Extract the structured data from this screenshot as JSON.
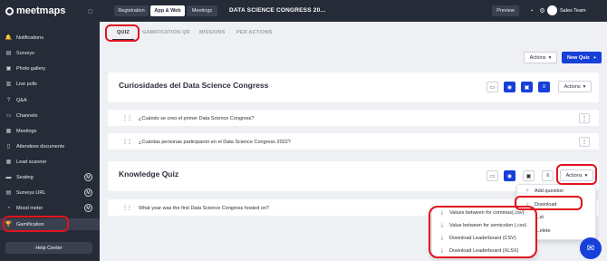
{
  "app": {
    "logo": "meetmaps"
  },
  "sidebar": {
    "items": [
      {
        "label": "Notifications",
        "icon": "bell-icon",
        "glyph": "🔔"
      },
      {
        "label": "Surveys",
        "icon": "clipboard-icon",
        "glyph": "▤"
      },
      {
        "label": "Photo gallery",
        "icon": "image-icon",
        "glyph": "▣"
      },
      {
        "label": "Live polls",
        "icon": "chart-icon",
        "glyph": "▥"
      },
      {
        "label": "Q&A",
        "icon": "qa-icon",
        "glyph": "?"
      },
      {
        "label": "Channels",
        "icon": "chat-icon",
        "glyph": "▭"
      },
      {
        "label": "Meetings",
        "icon": "calendar-icon",
        "glyph": "▦"
      },
      {
        "label": "Attendees documents",
        "icon": "document-icon",
        "glyph": "▯"
      },
      {
        "label": "Lead scanner",
        "icon": "scanner-icon",
        "glyph": "▦"
      },
      {
        "label": "Seating",
        "icon": "seat-icon",
        "glyph": "▬",
        "badge": "M"
      },
      {
        "label": "Surveys URL",
        "icon": "link-icon",
        "glyph": "▤",
        "badge": "M"
      },
      {
        "label": "Mood meter",
        "icon": "mood-icon",
        "glyph": "◔",
        "badge": "M"
      },
      {
        "label": "Gamification",
        "icon": "trophy-icon",
        "glyph": "🏆"
      }
    ],
    "help": "Help Center"
  },
  "topbar": {
    "segments": [
      "Registration",
      "App & Web",
      "Meetings"
    ],
    "event_title": "DATA SCIENCE CONGRESS 20...",
    "preview": "Preview",
    "user": "Sales Team"
  },
  "tabs": [
    "QUIZ",
    "GAMIFICATION QR",
    "MISSIONS",
    "PER ACTIONS"
  ],
  "toolbar": {
    "actions": "Actions",
    "new_quiz": "New Quiz"
  },
  "quiz1": {
    "title": "Curiosidades del Data Science Congress",
    "actions": "Actions",
    "questions": [
      "¿Cuándo se creo el primer Data Science Congress?",
      "¿Cuántas personas participaron en el Data Science Congress 2022?"
    ]
  },
  "quiz2": {
    "title": "Knowledge Quiz",
    "actions": "Actions",
    "questions": [
      "What year was the first Data Science Congress hosted on?"
    ]
  },
  "actions_menu": {
    "add_question": "Add question",
    "download": "Download",
    "partial_1": "...st",
    "partial_2": "...elete"
  },
  "download_menu": [
    "Values between for commas(.csv)",
    "Value between for semicolon (.csv)",
    "Download Leaderboard (CSV)",
    "Download Leaderboard (XLSX)"
  ],
  "colors": {
    "sidebar": "#262b38",
    "primary": "#1740d8",
    "highlight": "#e0141e"
  }
}
